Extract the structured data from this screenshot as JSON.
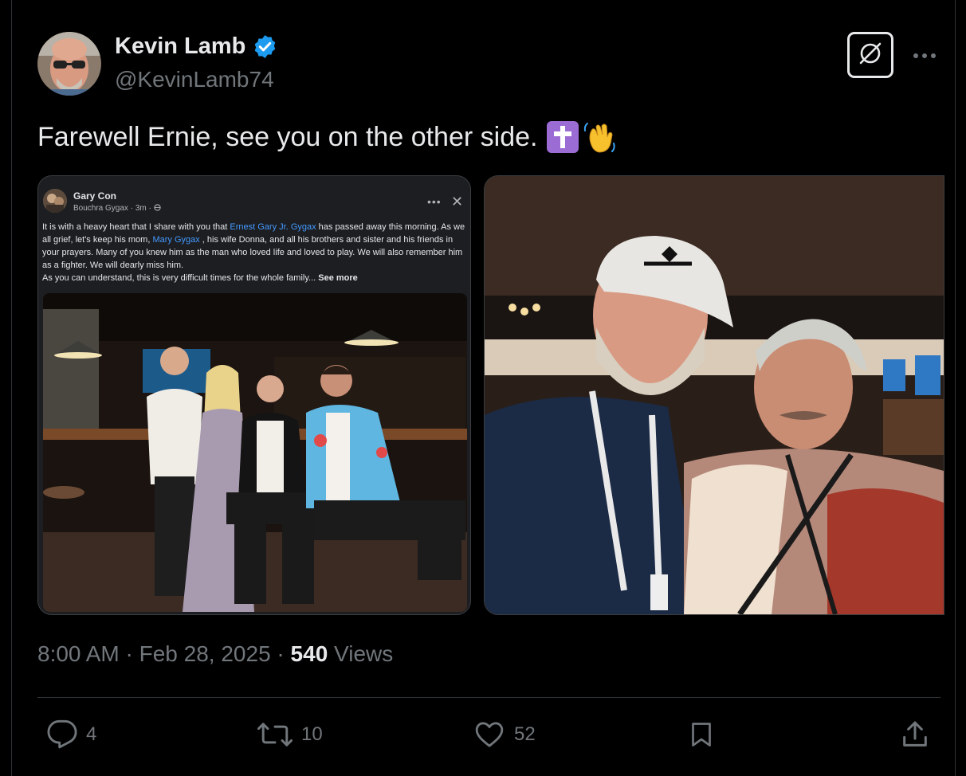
{
  "author": {
    "name": "Kevin Lamb",
    "handle": "@KevinLamb74"
  },
  "tweet": {
    "text": "Farewell Ernie, see you on the other side."
  },
  "embedded_post": {
    "page_name": "Gary Con",
    "meta": "Bouchra Gygax · 3m · ",
    "text_parts": {
      "p1": "It is with a heavy heart that I share with you that ",
      "link1": "Ernest Gary Jr. Gygax",
      "p2": " has passed away this morning. As we all grief, let's keep his mom, ",
      "link2": "Mary Gygax",
      "p3": " , his wife Donna, and all his brothers and sister and his friends in your prayers. Many of you knew him as the man who loved life and loved to play. We will also remember him as a fighter. We will dearly miss him.",
      "p4": "As you can understand, this is very difficult times for the whole family... ",
      "see_more": "See more"
    }
  },
  "timestamp": {
    "time": "8:00 AM",
    "date": "Feb 28, 2025",
    "views_count": "540",
    "views_label": "Views",
    "separator": " · "
  },
  "actions": {
    "replies": "4",
    "reposts": "10",
    "likes": "52"
  },
  "colors": {
    "background": "#000000",
    "text": "#e7e9ea",
    "secondary": "#71767b",
    "verified": "#1d9bf0",
    "fb_link": "#4599ff"
  },
  "icons": [
    "verified-badge-icon",
    "grok-icon",
    "more-options-icon",
    "cross-emoji-icon",
    "waving-hand-emoji-icon",
    "reply-icon",
    "repost-icon",
    "like-icon",
    "bookmark-icon",
    "share-icon"
  ]
}
